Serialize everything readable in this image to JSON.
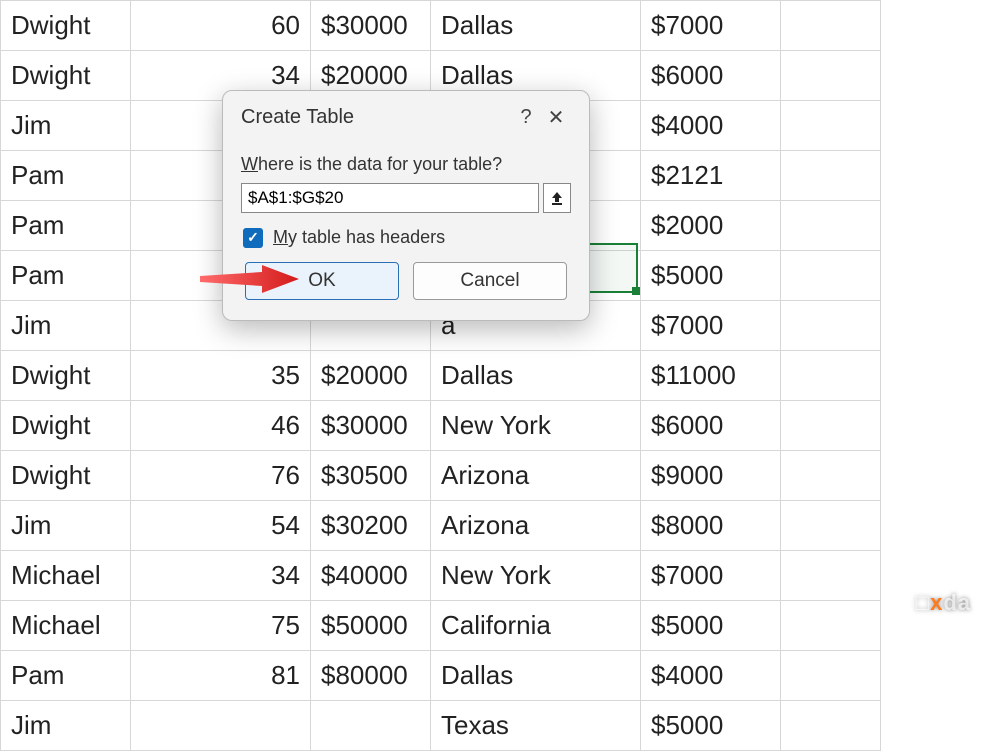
{
  "dialog": {
    "title": "Create Table",
    "help": "?",
    "close": "✕",
    "prompt_prefix": "W",
    "prompt_rest": "here is the data for your table?",
    "range_value": "$A$1:$G$20",
    "checkbox_checked": true,
    "checkbox_prefix": "M",
    "checkbox_rest": "y table has headers",
    "ok_label": "OK",
    "cancel_label": "Cancel"
  },
  "rows": [
    {
      "a": "Dwight",
      "b": "60",
      "c": "$30000",
      "d": "Dallas",
      "e": "$7000"
    },
    {
      "a": "Dwight",
      "b": "34",
      "c": "$20000",
      "d": "Dallas",
      "e": "$6000"
    },
    {
      "a": "Jim",
      "b": "",
      "c": "",
      "d": "",
      "e": "$4000"
    },
    {
      "a": "Pam",
      "b": "",
      "c": "",
      "d": "",
      "e": "$2121"
    },
    {
      "a": "Pam",
      "b": "",
      "c": "",
      "d": "",
      "e": "$2000"
    },
    {
      "a": "Pam",
      "b": "",
      "c": "",
      "d": "",
      "e": "$5000"
    },
    {
      "a": "Jim",
      "b": "",
      "c": "",
      "d": "a",
      "e": "$7000"
    },
    {
      "a": "Dwight",
      "b": "35",
      "c": "$20000",
      "d": "Dallas",
      "e": "$11000"
    },
    {
      "a": "Dwight",
      "b": "46",
      "c": "$30000",
      "d": "New York",
      "e": "$6000"
    },
    {
      "a": "Dwight",
      "b": "76",
      "c": "$30500",
      "d": "Arizona",
      "e": "$9000"
    },
    {
      "a": "Jim",
      "b": "54",
      "c": "$30200",
      "d": "Arizona",
      "e": "$8000"
    },
    {
      "a": "Michael",
      "b": "34",
      "c": "$40000",
      "d": "New York",
      "e": "$7000"
    },
    {
      "a": "Michael",
      "b": "75",
      "c": "$50000",
      "d": "California",
      "e": "$5000"
    },
    {
      "a": "Pam",
      "b": "81",
      "c": "$80000",
      "d": "Dallas",
      "e": "$4000"
    },
    {
      "a": "Jim",
      "b": "",
      "c": "",
      "d": "Texas",
      "e": "$5000"
    }
  ],
  "watermark": {
    "part1": "x",
    "part2": "da"
  }
}
